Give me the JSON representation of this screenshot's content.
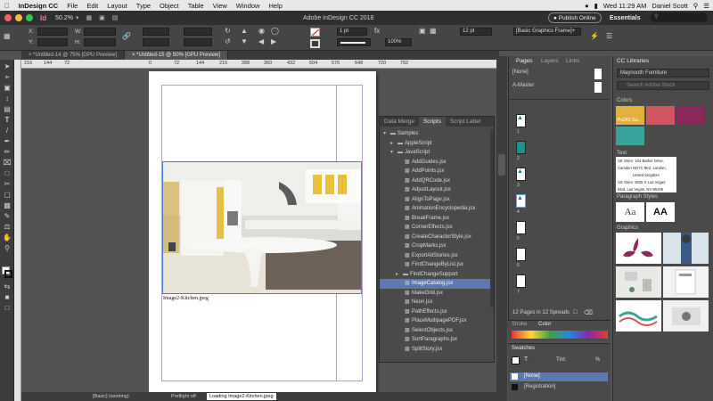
{
  "menubar": {
    "app_name": "InDesign CC",
    "items": [
      "File",
      "Edit",
      "Layout",
      "Type",
      "Object",
      "Table",
      "View",
      "Window",
      "Help"
    ],
    "time": "Wed 11:29 AM",
    "user": "Daniel Scott"
  },
  "appbar": {
    "zoom": "50.2%",
    "title": "Adobe InDesign CC 2018",
    "publish_label": "Publish Online",
    "workspace": "Essentials",
    "search_placeholder": ""
  },
  "control": {
    "x_label": "X:",
    "y_label": "Y:",
    "w_label": "W:",
    "h_label": "H:",
    "stroke_weight": "1 pt",
    "opacity": "100%",
    "size_pt": "12 pt",
    "frame_style": "[Basic Graphics Frame]+"
  },
  "tabs": [
    {
      "label": "*Untitled-14 @ 75% [GPU Preview]",
      "active": false
    },
    {
      "label": "*Untitled-15 @ 50% [GPU Preview]",
      "active": true
    }
  ],
  "ruler": {
    "ticks": [
      "216",
      "144",
      "72",
      "0",
      "72",
      "144",
      "216",
      "288",
      "360",
      "432",
      "504",
      "576",
      "648",
      "720",
      "792"
    ]
  },
  "document": {
    "caption": "Image2-Kitchen.jpeg"
  },
  "scripts_panel": {
    "tabs": [
      "Data Merge",
      "Scripts",
      "Script Label"
    ],
    "items": [
      {
        "label": "Samples",
        "level": 0,
        "type": "folder"
      },
      {
        "label": "AppleScript",
        "level": 1,
        "type": "folder"
      },
      {
        "label": "JavaScript",
        "level": 1,
        "type": "folder"
      },
      {
        "label": "AddGuides.jsx",
        "level": 2,
        "type": "file"
      },
      {
        "label": "AddPoints.jsx",
        "level": 2,
        "type": "file"
      },
      {
        "label": "AddQRCode.jsx",
        "level": 2,
        "type": "file"
      },
      {
        "label": "AdjustLayout.jsx",
        "level": 2,
        "type": "file"
      },
      {
        "label": "AlignToPage.jsx",
        "level": 2,
        "type": "file"
      },
      {
        "label": "AnimationEncyclopedia.jsx",
        "level": 2,
        "type": "file"
      },
      {
        "label": "BreakFrame.jsx",
        "level": 2,
        "type": "file"
      },
      {
        "label": "CornerEffects.jsx",
        "level": 2,
        "type": "file"
      },
      {
        "label": "CreateCharacterStyle.jsx",
        "level": 2,
        "type": "file"
      },
      {
        "label": "CropMarks.jsx",
        "level": 2,
        "type": "file"
      },
      {
        "label": "ExportAllStories.jsx",
        "level": 2,
        "type": "file"
      },
      {
        "label": "FindChangeByList.jsx",
        "level": 2,
        "type": "file"
      },
      {
        "label": "FindChangeSupport",
        "level": 2,
        "type": "folder"
      },
      {
        "label": "ImageCatalog.jsx",
        "level": 2,
        "type": "file",
        "selected": true
      },
      {
        "label": "MakeGrid.jsx",
        "level": 2,
        "type": "file"
      },
      {
        "label": "Neon.jsx",
        "level": 2,
        "type": "file"
      },
      {
        "label": "PathEffects.jsx",
        "level": 2,
        "type": "file"
      },
      {
        "label": "PlaceMultipagePDF.jsx",
        "level": 2,
        "type": "file"
      },
      {
        "label": "SelectObjects.jsx",
        "level": 2,
        "type": "file"
      },
      {
        "label": "SortParagraphs.jsx",
        "level": 2,
        "type": "file"
      },
      {
        "label": "SplitStory.jsx",
        "level": 2,
        "type": "file"
      }
    ]
  },
  "pages_panel": {
    "tabs": [
      "Pages",
      "Layers",
      "Links"
    ],
    "none_label": "[None]",
    "master_label": "A-Master",
    "page_numbers": [
      "1",
      "2",
      "3",
      "4",
      "5",
      "6",
      "7"
    ],
    "footer": "12 Pages in 12 Spreads"
  },
  "stroke_panel": {
    "tabs": [
      "Stroke",
      "Color"
    ]
  },
  "swatches_panel": {
    "title": "Swatches",
    "tint_label": "Tint:",
    "tint_unit": "%",
    "items": [
      "[None]",
      "[Registration]"
    ]
  },
  "cc_libraries": {
    "title": "CC Libraries",
    "library_name": "Maynooth Furniture",
    "search_placeholder": "Search Adobe Stock",
    "colors_label": "Colors",
    "swatch_label": "Pu243 Gu...",
    "colors": [
      "#e2b13c",
      "#d45562",
      "#8b2a5a",
      "#3aa39c"
    ],
    "text_label": "Text",
    "text_sample": [
      "UK Store: 104 Barker Drive,",
      "Camden NO7C 9K2, London,",
      "United Kingdom",
      "US Store: 5025 S Las Vegas",
      "Blvd, Las Vegas, NV 89109"
    ],
    "para_label": "Paragraph Styles",
    "para_samples": [
      "Aa",
      "AA"
    ],
    "graphics_label": "Graphics"
  },
  "status": {
    "style": "[Basic] (working)",
    "preflight": "Preflight off",
    "filename": "Loading Image2-Kitchen.jpeg"
  }
}
